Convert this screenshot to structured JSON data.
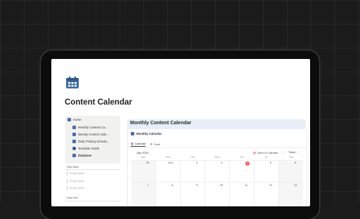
{
  "page": {
    "title": "Content Calendar",
    "icon": "calendar-icon"
  },
  "colors": {
    "accent": "#4a6fa5",
    "today": "#eb5757",
    "header_bg": "#e7eef5"
  },
  "sidebar": {
    "home_label": "Home",
    "items": [
      {
        "label": "Monthly Content Ca...",
        "icon": "calendar-icon"
      },
      {
        "label": "Weekly Content Cale...",
        "icon": "calendar-icon"
      },
      {
        "label": "Daily Posting Schedu...",
        "icon": "calendar-icon"
      },
      {
        "label": "Template Guide",
        "icon": "info-icon"
      },
      {
        "label": "Database",
        "icon": "database-icon"
      }
    ]
  },
  "sections": {
    "new_date": {
      "label": "New Date",
      "items": [
        "Empty quote",
        "Empty quote",
        "Empty quote"
      ]
    },
    "new_text": {
      "label": "New Text"
    }
  },
  "main": {
    "title": "Monthly Content Calendar",
    "view_title": "Monthly Calendar",
    "tabs": [
      {
        "label": "Calendar",
        "icon": "calendar-icon",
        "active": true
      },
      {
        "label": "Tools",
        "icon": "tools-icon",
        "active": false
      }
    ],
    "month_label": "July 2024",
    "open_in_calendar": "Open in Calendar",
    "today_label": "Today",
    "weekdays": [
      "Sun",
      "Mon",
      "Tue",
      "Wed",
      "Thu",
      "Fri",
      "Sat"
    ],
    "week1": [
      "30",
      "Jul 1",
      "2",
      "3",
      "4",
      "5",
      "6"
    ],
    "week2": [
      "7",
      "8",
      "9",
      "10",
      "11",
      "12",
      "13"
    ],
    "today_index": 4
  }
}
